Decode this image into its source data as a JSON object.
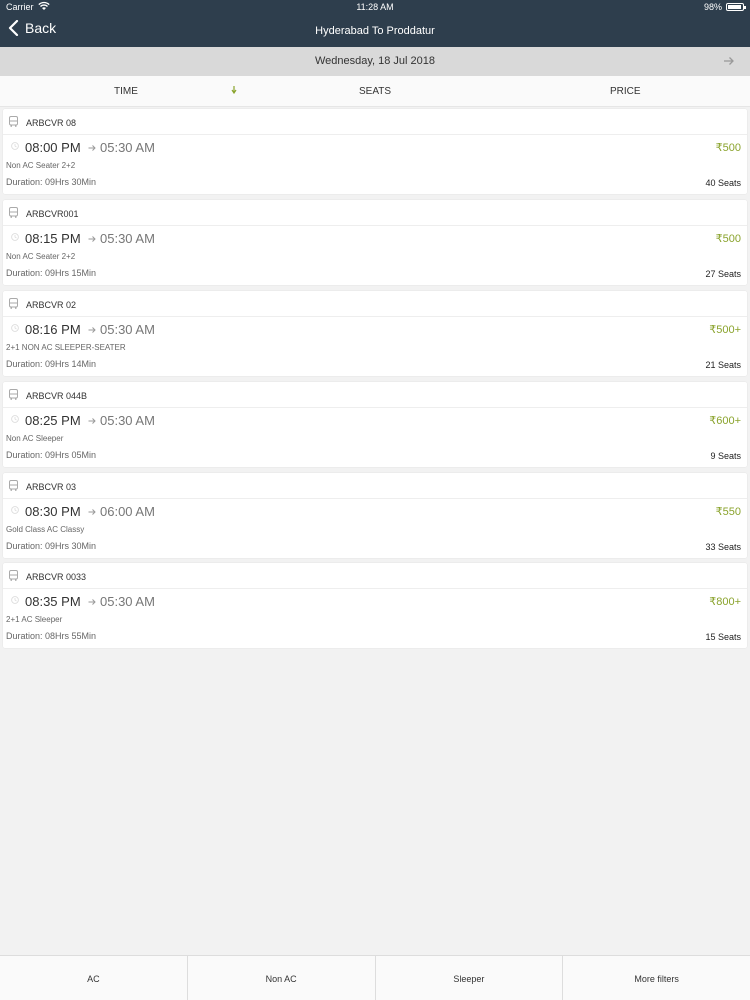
{
  "status": {
    "carrier": "Carrier",
    "time": "11:28 AM",
    "battery": "98%"
  },
  "nav": {
    "back_label": "Back",
    "title": "Hyderabad To Proddatur"
  },
  "date": "Wednesday, 18 Jul 2018",
  "sort": {
    "time": "TIME",
    "seats": "SEATS",
    "price": "PRICE"
  },
  "buses": [
    {
      "operator": "ARBCVR 08",
      "departure": "08:00 PM",
      "arrival": "05:30 AM",
      "type": "Non AC Seater 2+2",
      "duration": "Duration: 09Hrs 30Min",
      "price": "₹500",
      "seats": "40 Seats"
    },
    {
      "operator": "ARBCVR001",
      "departure": "08:15 PM",
      "arrival": "05:30 AM",
      "type": "Non AC Seater 2+2",
      "duration": "Duration: 09Hrs 15Min",
      "price": "₹500",
      "seats": "27 Seats"
    },
    {
      "operator": "ARBCVR 02",
      "departure": "08:16 PM",
      "arrival": "05:30 AM",
      "type": "2+1 NON AC SLEEPER-SEATER",
      "duration": "Duration: 09Hrs 14Min",
      "price": "₹500+",
      "seats": "21 Seats"
    },
    {
      "operator": "ARBCVR 044B",
      "departure": "08:25 PM",
      "arrival": "05:30 AM",
      "type": "Non AC Sleeper",
      "duration": "Duration: 09Hrs 05Min",
      "price": "₹600+",
      "seats": "9 Seats"
    },
    {
      "operator": "ARBCVR 03",
      "departure": "08:30 PM",
      "arrival": "06:00 AM",
      "type": "Gold Class AC Classy",
      "duration": "Duration: 09Hrs 30Min",
      "price": "₹550",
      "seats": "33 Seats"
    },
    {
      "operator": "ARBCVR 0033",
      "departure": "08:35 PM",
      "arrival": "05:30 AM",
      "type": "2+1 AC Sleeper",
      "duration": "Duration: 08Hrs 55Min",
      "price": "₹800+",
      "seats": "15 Seats"
    }
  ],
  "filters": {
    "ac": "AC",
    "non_ac": "Non AC",
    "sleeper": "Sleeper",
    "more": "More filters"
  },
  "colors": {
    "header": "#2e3e4d",
    "price": "#8aa32c",
    "datebar": "#d9d9d9"
  }
}
